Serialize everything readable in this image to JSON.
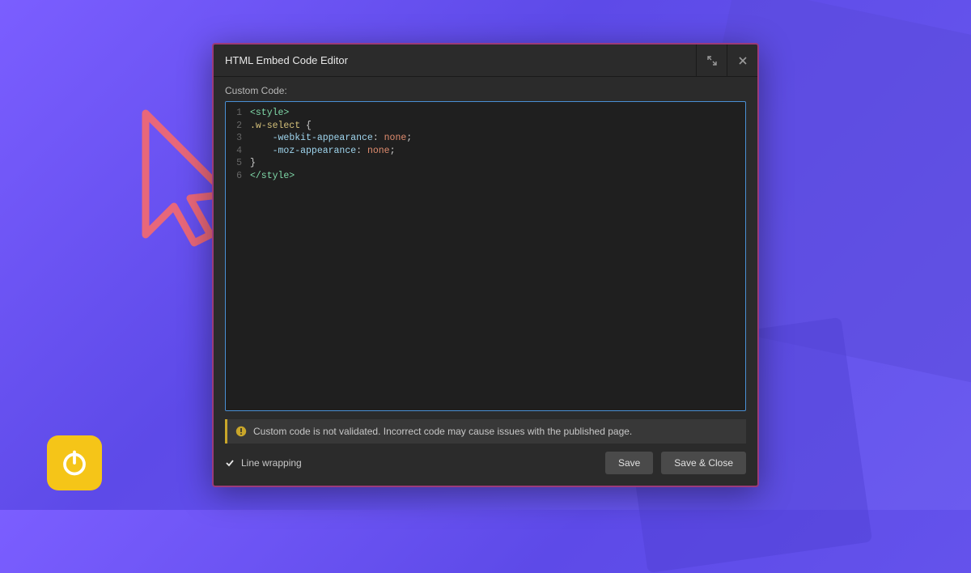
{
  "modal": {
    "title": "HTML Embed Code Editor",
    "section_label": "Custom Code:",
    "code_lines": [
      {
        "n": 1,
        "tokens": [
          [
            "tag",
            "<style>"
          ]
        ]
      },
      {
        "n": 2,
        "tokens": [
          [
            "sel",
            ".w-select"
          ],
          [
            "punct",
            " {"
          ]
        ]
      },
      {
        "n": 3,
        "tokens": [
          [
            "punct",
            "    "
          ],
          [
            "prop",
            "-webkit-appearance"
          ],
          [
            "punct",
            ": "
          ],
          [
            "val",
            "none"
          ],
          [
            "punct",
            ";"
          ]
        ]
      },
      {
        "n": 4,
        "tokens": [
          [
            "punct",
            "    "
          ],
          [
            "prop",
            "-moz-appearance"
          ],
          [
            "punct",
            ": "
          ],
          [
            "val",
            "none"
          ],
          [
            "punct",
            ";"
          ]
        ]
      },
      {
        "n": 5,
        "tokens": [
          [
            "punct",
            "}"
          ]
        ]
      },
      {
        "n": 6,
        "tokens": [
          [
            "tag",
            "</style>"
          ]
        ]
      }
    ],
    "warning_text": "Custom code is not validated. Incorrect code may cause issues with the published page.",
    "line_wrapping_label": "Line wrapping",
    "line_wrapping_checked": true,
    "save_label": "Save",
    "save_close_label": "Save & Close"
  },
  "icons": {
    "expand": "expand-icon",
    "close": "close-icon",
    "warning": "warning-icon",
    "check": "check-icon",
    "power": "power-icon",
    "cursor": "cursor-icon"
  }
}
